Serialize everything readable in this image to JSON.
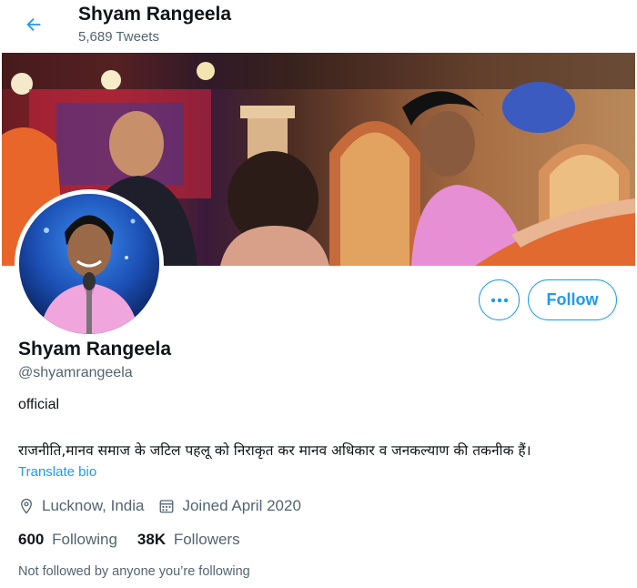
{
  "header": {
    "title": "Shyam Rangeela",
    "tweet_count": "5,689 Tweets"
  },
  "profile": {
    "display_name": "Shyam Rangeela",
    "handle": "@shyamrangeela",
    "bio_line1": "official",
    "bio_line2": "राजनीति,मानव समाज के जटिल पहलू को निराकृत कर मानव अधिकार व जनकल्याण की तकनीक हैं।",
    "translate_label": "Translate bio",
    "location": "Lucknow, India",
    "joined": "Joined April 2020",
    "following_count": "600",
    "following_label": "Following",
    "followers_count": "38K",
    "followers_label": "Followers",
    "not_followed_text": "Not followed by anyone you’re following"
  },
  "actions": {
    "follow_label": "Follow"
  },
  "icons": {
    "back": "back-arrow-icon",
    "more": "more-dots-icon",
    "location": "location-pin-icon",
    "calendar": "calendar-icon"
  },
  "colors": {
    "accent": "#1d9bf0",
    "text_primary": "#0f1419",
    "text_secondary": "#536471"
  }
}
